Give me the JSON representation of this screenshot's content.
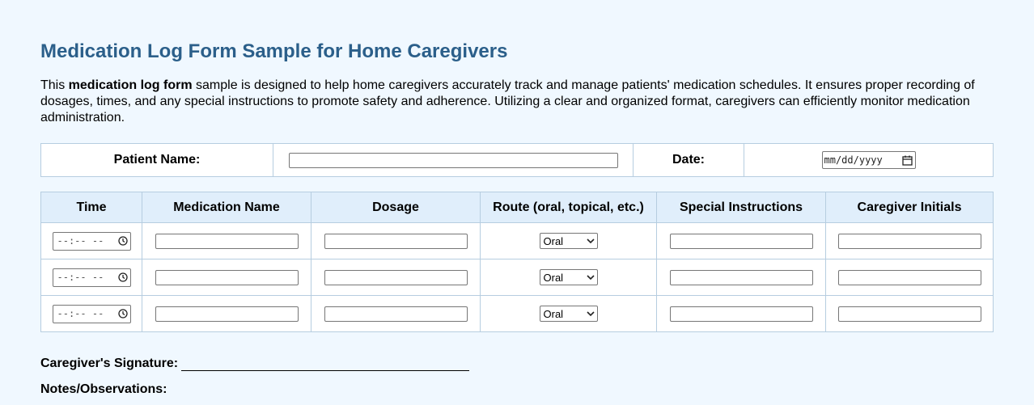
{
  "page": {
    "title": "Medication Log Form Sample for Home Caregivers",
    "intro_prefix": "This ",
    "intro_bold": "medication log form",
    "intro_suffix": " sample is designed to help home caregivers accurately track and manage patients' medication schedules. It ensures proper recording of dosages, times, and any special instructions to promote safety and adherence. Utilizing a clear and organized format, caregivers can efficiently monitor medication administration."
  },
  "patient_info": {
    "name_label": "Patient Name:",
    "name_value": "",
    "date_label": "Date:",
    "date_placeholder": "mm/dd/yyyy"
  },
  "log_table": {
    "headers": [
      "Time",
      "Medication Name",
      "Dosage",
      "Route (oral, topical, etc.)",
      "Special Instructions",
      "Caregiver Initials"
    ],
    "rows": [
      {
        "time_placeholder": "--:-- --",
        "medication": "",
        "dosage": "",
        "route": "Oral",
        "instructions": "",
        "initials": ""
      },
      {
        "time_placeholder": "--:-- --",
        "medication": "",
        "dosage": "",
        "route": "Oral",
        "instructions": "",
        "initials": ""
      },
      {
        "time_placeholder": "--:-- --",
        "medication": "",
        "dosage": "",
        "route": "Oral",
        "instructions": "",
        "initials": ""
      }
    ]
  },
  "footer": {
    "signature_label": "Caregiver's Signature:",
    "notes_label": "Notes/Observations:"
  },
  "icons": {
    "time": "clock-icon",
    "date": "calendar-icon",
    "select": "chevron-down-icon"
  },
  "colors": {
    "background": "#f0f8ff",
    "title": "#2b5f8a",
    "header_bg": "#e0eefb",
    "border": "#b6cde0"
  }
}
